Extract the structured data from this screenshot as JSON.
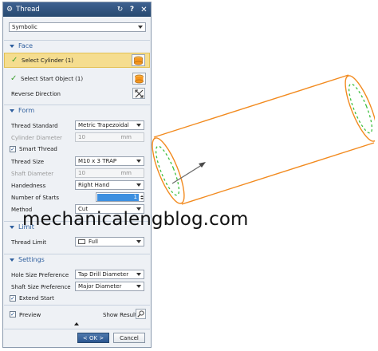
{
  "dialog": {
    "title": "Thread",
    "type_select": "Symbolic",
    "face": {
      "header": "Face",
      "select_cylinder": "Select Cylinder (1)",
      "select_start_object": "Select Start Object (1)",
      "reverse_direction": "Reverse Direction"
    },
    "form": {
      "header": "Form",
      "thread_standard_label": "Thread Standard",
      "thread_standard_value": "Metric Trapezoidal",
      "cylinder_diameter_label": "Cylinder Diameter",
      "cylinder_diameter_value": "10",
      "cylinder_diameter_unit": "mm",
      "smart_thread_label": "Smart Thread",
      "thread_size_label": "Thread Size",
      "thread_size_value": "M10 x 3 TRAP",
      "shaft_diameter_label": "Shaft Diameter",
      "shaft_diameter_value": "10",
      "shaft_diameter_unit": "mm",
      "handedness_label": "Handedness",
      "handedness_value": "Right Hand",
      "number_of_starts_label": "Number of Starts",
      "number_of_starts_value": "1",
      "method_label": "Method",
      "method_value": "Cut"
    },
    "limit": {
      "header": "Limit",
      "thread_limit_label": "Thread Limit",
      "thread_limit_value": "Full"
    },
    "settings": {
      "header": "Settings",
      "hole_size_label": "Hole Size Preference",
      "hole_size_value": "Tap Drill Diameter",
      "shaft_size_label": "Shaft Size Preference",
      "shaft_size_value": "Major Diameter",
      "extend_start_label": "Extend Start"
    },
    "footer": {
      "preview_label": "Preview",
      "show_result_label": "Show Result",
      "ok_label": "< OK >",
      "cancel_label": "Cancel"
    }
  },
  "watermark": "mechanicalengblog.com",
  "colors": {
    "title_bar": "#30547f",
    "section_header": "#2f5f9e",
    "active_selection": "#f5dd8f",
    "cylinder_edge": "#f28a1e",
    "thread_marker": "#3fbf3f"
  },
  "icons": [
    "gear-icon",
    "reset-icon",
    "help-icon",
    "close-icon",
    "check-icon",
    "face-select-icon",
    "reverse-direction-icon",
    "limit-face-icon",
    "show-result-icon"
  ]
}
